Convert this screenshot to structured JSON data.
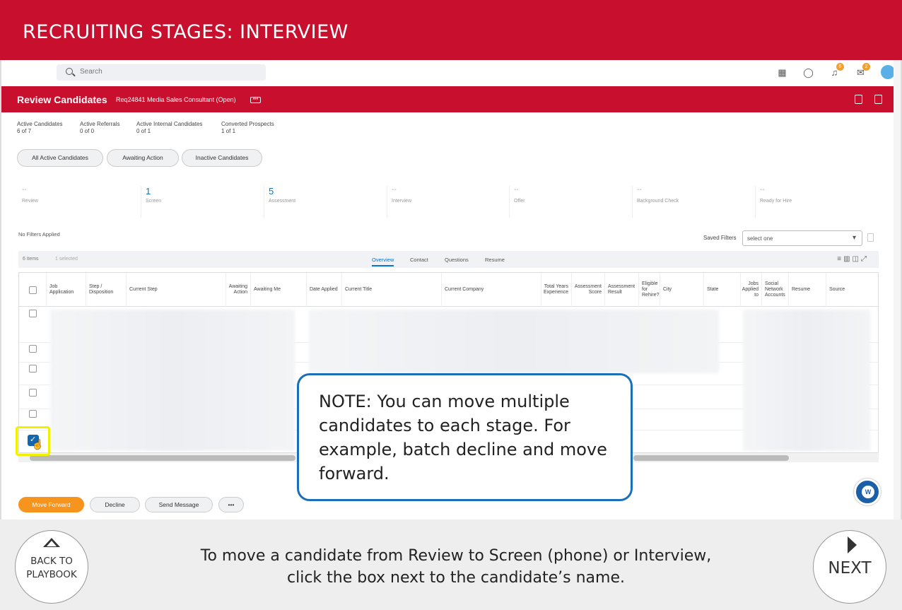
{
  "banner": {
    "title": "RECRUITING STAGES: INTERVIEW"
  },
  "topbar": {
    "search_placeholder": "Search",
    "notif_count": "6",
    "inbox_count": "2"
  },
  "header": {
    "title": "Review Candidates",
    "subtitle": "Req24841 Media Sales Consultant (Open)",
    "more": "•••"
  },
  "summary": [
    {
      "label": "Active Candidates",
      "value": "6 of 7"
    },
    {
      "label": "Active Referrals",
      "value": "0 of 0"
    },
    {
      "label": "Active Internal Candidates",
      "value": "0 of 1"
    },
    {
      "label": "Converted Prospects",
      "value": "1 of 1"
    }
  ],
  "pills": [
    "All Active Candidates",
    "Awaiting Action",
    "Inactive Candidates"
  ],
  "stages": [
    {
      "count": "--",
      "label": "Review"
    },
    {
      "count": "1",
      "label": "Screen"
    },
    {
      "count": "5",
      "label": "Assessment"
    },
    {
      "count": "--",
      "label": "Interview"
    },
    {
      "count": "--",
      "label": "Offer"
    },
    {
      "count": "--",
      "label": "Background Check"
    },
    {
      "count": "--",
      "label": "Ready for Hire"
    }
  ],
  "filters": {
    "applied": "No Filters Applied",
    "saved_label": "Saved Filters",
    "saved_value": "select one"
  },
  "grid": {
    "items": "6 items",
    "selected": "1 selected",
    "tabs": [
      "Overview",
      "Contact",
      "Questions",
      "Resume"
    ],
    "columns": [
      "Job Application",
      "Step / Disposition",
      "Current Step",
      "Awaiting Action",
      "Awaiting Me",
      "Date Applied",
      "Current Title",
      "Current Company",
      "Total Years Experience",
      "Assessment Score",
      "Assessment Result",
      "Eligible for Rehire?",
      "City",
      "State",
      "Jobs Applied to",
      "Social Network Accounts",
      "Resume",
      "Source"
    ]
  },
  "actions": {
    "move_forward": "Move Forward",
    "decline": "Decline",
    "send_message": "Send Message",
    "more": "•••"
  },
  "note": {
    "text": "NOTE: You can move multiple candidates to each stage. For example, batch decline and move forward."
  },
  "footer": {
    "back": "BACK TO PLAYBOOK",
    "next": "NEXT",
    "instruction_line1": "To move a candidate from Review to Screen (phone) or Interview,",
    "instruction_line2": "click the box next to the candidate’s name."
  },
  "colors": {
    "brand_red": "#c8102e",
    "accent_orange": "#f7941d",
    "link_blue": "#0875c9",
    "note_border": "#1a6fb8",
    "highlight": "#f0f000"
  }
}
